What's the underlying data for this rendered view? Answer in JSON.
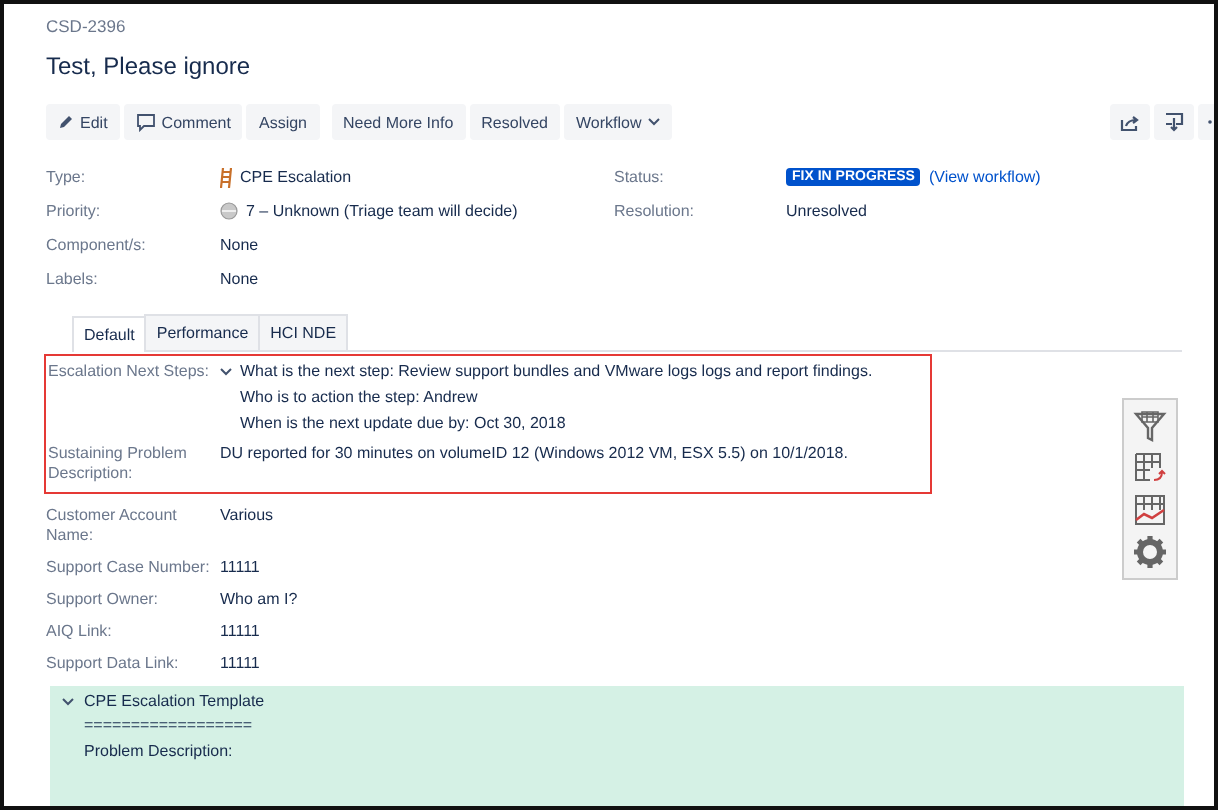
{
  "issue_key": "CSD-2396",
  "title": "Test, Please ignore",
  "toolbar": {
    "buttons": [
      {
        "label": "Edit",
        "kind": "edit"
      },
      {
        "label": "Comment",
        "kind": "comment"
      },
      {
        "label": "Assign",
        "kind": "plain"
      },
      {
        "label": "Need More Info",
        "kind": "plain"
      },
      {
        "label": "Resolved",
        "kind": "plain"
      },
      {
        "label": "Workflow",
        "kind": "dropdown"
      }
    ]
  },
  "details": {
    "left": [
      {
        "label": "Type:",
        "value": "CPE Escalation",
        "kind": "type"
      },
      {
        "label": "Priority:",
        "value": "7 – Unknown (Triage team will decide)",
        "kind": "priority"
      },
      {
        "label": "Component/s:",
        "value": "None",
        "kind": "plain"
      },
      {
        "label": "Labels:",
        "value": "None",
        "kind": "plain"
      }
    ],
    "status": {
      "label": "Status:",
      "badge": "FIX IN PROGRESS",
      "link": "(View workflow)"
    },
    "resolution": {
      "label": "Resolution:",
      "value": "Unresolved"
    }
  },
  "tabs": [
    {
      "label": "Default",
      "selected": true
    },
    {
      "label": "Performance",
      "selected": false
    },
    {
      "label": "HCI NDE",
      "selected": false
    }
  ],
  "highlighted_fields": [
    {
      "label": "Escalation Next Steps:",
      "expanded": true,
      "lines": [
        "What is the next step: Review support bundles and VMware logs logs and report findings.",
        "Who is to action the step: Andrew",
        "When is the next update due by: Oct 30, 2018"
      ]
    },
    {
      "label": "Sustaining Problem Description:",
      "lines": [
        "DU reported for 30 minutes on volumeID 12 (Windows 2012 VM, ESX 5.5) on 10/1/2018."
      ]
    }
  ],
  "fields": [
    {
      "label": "Customer Account Name:",
      "value": "Various"
    },
    {
      "label": "Support Case Number:",
      "value": "11111"
    },
    {
      "label": "Support Owner:",
      "value": "Who am I?"
    },
    {
      "label": "AIQ Link:",
      "value": "11111"
    },
    {
      "label": "Support Data Link:",
      "value": "11111"
    }
  ],
  "template": {
    "title": "CPE Escalation Template",
    "expanded": true,
    "lines": [
      "==================",
      "Problem Description:"
    ]
  }
}
